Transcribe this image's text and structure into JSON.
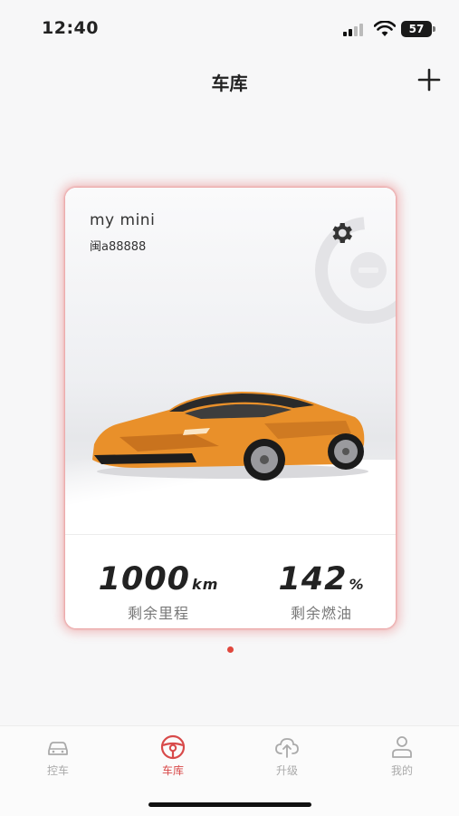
{
  "status_bar": {
    "time": "12:40",
    "battery_level": "57"
  },
  "nav": {
    "title": "车库",
    "add_icon": "plus-icon"
  },
  "vehicle_card": {
    "name": "my mini",
    "plate": "闽a88888",
    "settings_icon": "gear-icon",
    "range": {
      "value": "1000",
      "unit": "km",
      "label": "剩余里程"
    },
    "fuel": {
      "value": "142",
      "unit": "%",
      "label": "剩余燃油"
    }
  },
  "pager": {
    "pages": 1,
    "current": 1
  },
  "tab_bar": {
    "tabs": [
      {
        "label": "控车",
        "icon": "car-icon",
        "active": false
      },
      {
        "label": "车库",
        "icon": "steering-wheel-icon",
        "active": true
      },
      {
        "label": "升级",
        "icon": "cloud-upload-icon",
        "active": false
      },
      {
        "label": "我的",
        "icon": "user-icon",
        "active": false
      }
    ]
  },
  "colors": {
    "accent": "#d84a4a",
    "card_glow": "#e87878",
    "car_body": "#e9902a"
  }
}
